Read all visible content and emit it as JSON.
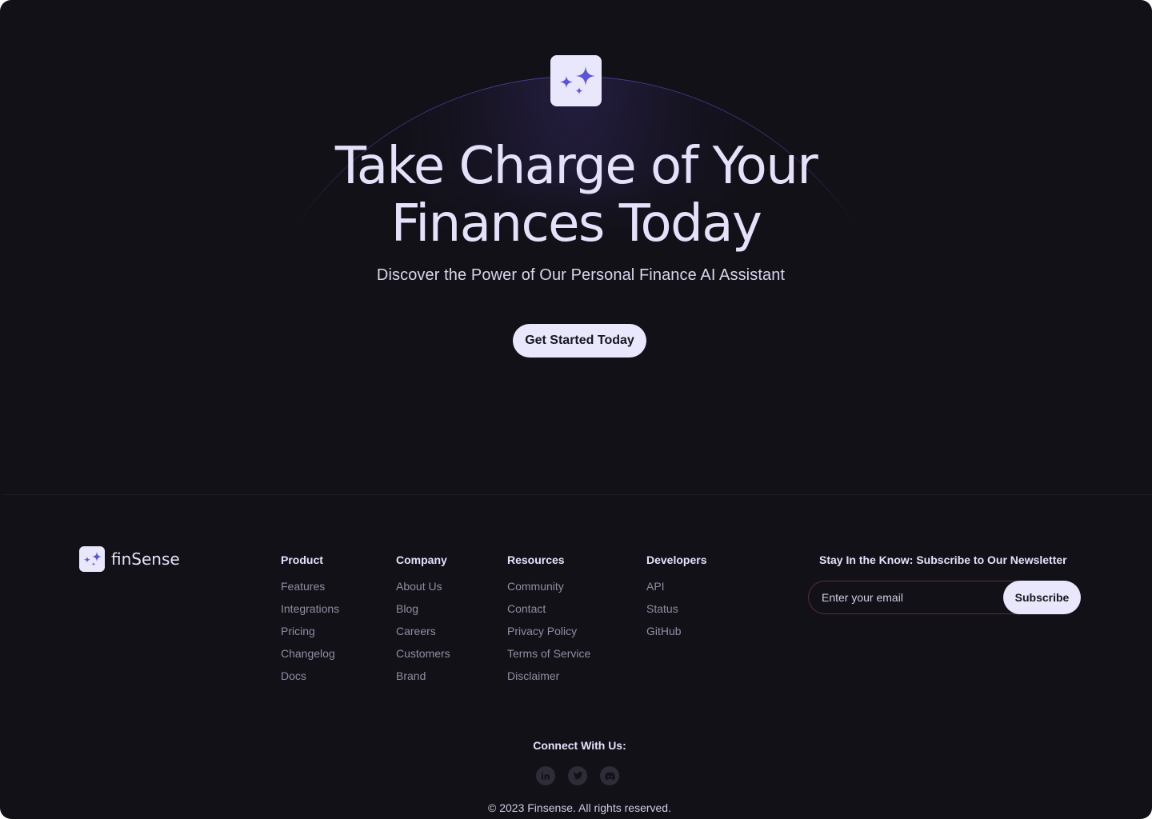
{
  "hero": {
    "logo_icon": "sparkles-icon",
    "title_line1": "Take Charge of Your",
    "title_line2": "Finances Today",
    "subtitle": "Discover the Power of Our Personal Finance AI Assistant",
    "cta_label": "Get Started Today"
  },
  "brand": {
    "logo_icon": "sparkles-icon",
    "name": "finSense"
  },
  "footer": {
    "columns": [
      {
        "title": "Product",
        "links": [
          "Features",
          "Integrations",
          "Pricing",
          "Changelog",
          "Docs"
        ]
      },
      {
        "title": "Company",
        "links": [
          "About Us",
          "Blog",
          "Careers",
          "Customers",
          "Brand"
        ]
      },
      {
        "title": "Resources",
        "links": [
          "Community",
          "Contact",
          "Privacy Policy",
          "Terms of Service",
          "Disclaimer"
        ]
      },
      {
        "title": "Developers",
        "links": [
          "API",
          "Status",
          "GitHub"
        ]
      }
    ],
    "newsletter": {
      "title": "Stay In the Know: Subscribe to Our Newsletter",
      "placeholder": "Enter your email",
      "button_label": "Subscribe"
    },
    "connect_title": "Connect With Us:",
    "socials": [
      {
        "icon": "linkedin-icon"
      },
      {
        "icon": "twitter-icon"
      },
      {
        "icon": "discord-icon"
      }
    ],
    "copyright": "© 2023 Finsense. All rights reserved."
  },
  "colors": {
    "background": "#121118",
    "accent": "#5b54d6",
    "button_bg": "#e9e7fb",
    "text_primary": "#e4e2fb",
    "text_muted": "#8f8da3"
  }
}
